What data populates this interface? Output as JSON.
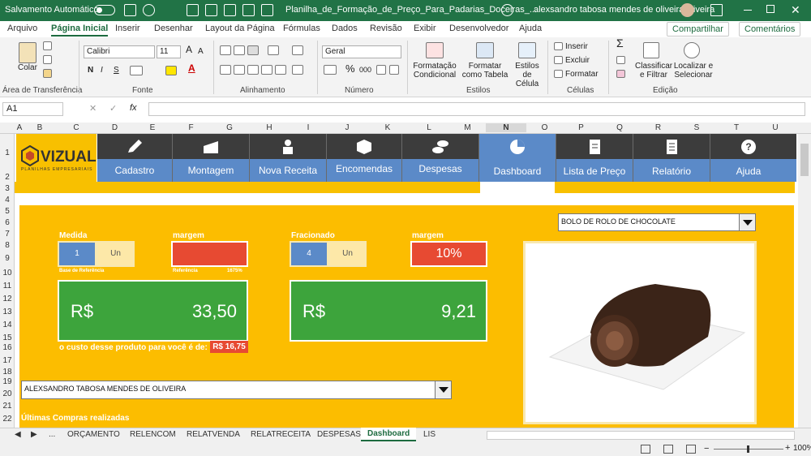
{
  "titlebar": {
    "autosave_label": "Salvamento Automático",
    "filename": "Planilha_de_Formação_de_Preço_Para_Padarias_Doceiras_...",
    "user": "alexsandro tabosa mendes de oliveira oliveira"
  },
  "menu": {
    "tabs": [
      "Arquivo",
      "Página Inicial",
      "Inserir",
      "Desenhar",
      "Layout da Página",
      "Fórmulas",
      "Dados",
      "Revisão",
      "Exibir",
      "Desenvolvedor",
      "Ajuda"
    ],
    "share_label": "Compartilhar",
    "comments_label": "Comentários"
  },
  "ribbon": {
    "paste_label": "Colar",
    "clipboard_group": "Área de Transferência",
    "font_name": "Calibri",
    "font_size": "11",
    "bold": "N",
    "italic": "I",
    "underline": "S",
    "font_group": "Fonte",
    "align_group": "Alinhamento",
    "number_format": "Geral",
    "percent": "%",
    "thousands": "000",
    "number_group": "Número",
    "conditional_label": "Formatação Condicional",
    "table_label": "Formatar como Tabela",
    "styles_label": "Estilos de Célula",
    "styles_group": "Estilos",
    "insert_label": "Inserir",
    "delete_label": "Excluir",
    "format_label": "Formatar",
    "cells_group": "Células",
    "sort_label": "Classificar e Filtrar",
    "find_label": "Localizar e Selecionar",
    "edit_group": "Edição"
  },
  "formula_bar": {
    "name_box": "A1",
    "fx": "fx"
  },
  "columns": [
    "A",
    "B",
    "C",
    "D",
    "E",
    "F",
    "G",
    "H",
    "I",
    "J",
    "K",
    "L",
    "M",
    "N",
    "O",
    "P",
    "Q",
    "R",
    "S",
    "T",
    "U"
  ],
  "rows": [
    "1",
    "2",
    "3",
    "4",
    "5",
    "6",
    "7",
    "8",
    "9",
    "10",
    "11",
    "12",
    "13",
    "14",
    "15",
    "16",
    "17",
    "18",
    "19",
    "20",
    "21",
    "22"
  ],
  "logo": {
    "name": "VIZUAL",
    "tagline": "PLANILHAS EMPRESARIAIS"
  },
  "nav": [
    {
      "label": "Cadastro",
      "icon": "pencil-icon"
    },
    {
      "label": "Montagem",
      "icon": "cake-slice-icon"
    },
    {
      "label": "Nova Receita",
      "icon": "chef-icon"
    },
    {
      "label": "Encomendas",
      "icon": "box-icon"
    },
    {
      "label": "Despesas",
      "icon": "coins-icon"
    },
    {
      "label": "Dashboard",
      "icon": "pie-chart-icon",
      "active": true
    },
    {
      "label": "Lista de Preço",
      "icon": "document-icon"
    },
    {
      "label": "Relatório",
      "icon": "report-icon"
    },
    {
      "label": "Ajuda",
      "icon": "question-icon"
    }
  ],
  "dashboard": {
    "product_dropdown": "BOLO DE ROLO DE CHOCOLATE",
    "medida_label": "Medida",
    "medida_value": "1",
    "medida_unit": "Un",
    "base_ref": "Base de Referência",
    "margem_label1": "margem",
    "margem_value1": "",
    "referencia": "Referência",
    "referencia_pct": "1675%",
    "fracionado_label": "Fracionado",
    "fracionado_value": "4",
    "fracionado_unit": "Un",
    "margem_label2": "margem",
    "margem_value2": "10%",
    "price1_currency": "R$",
    "price1_value": "33,50",
    "price2_currency": "R$",
    "price2_value": "9,21",
    "cost_text": "o custo desse produto para você é de:",
    "cost_value": "R$ 16,75",
    "customer_dropdown": "ALEXSANDRO TABOSA MENDES DE OLIVEIRA",
    "last_purchases": "Últimas Compras realizadas"
  },
  "sheet_tabs": [
    "...",
    "ORÇAMENTO",
    "RELENCOM",
    "RELATVENDA",
    "RELATRECEITA",
    "DESPESAS",
    "Dashboard",
    "LIS"
  ],
  "status": {
    "zoom": "100%"
  }
}
